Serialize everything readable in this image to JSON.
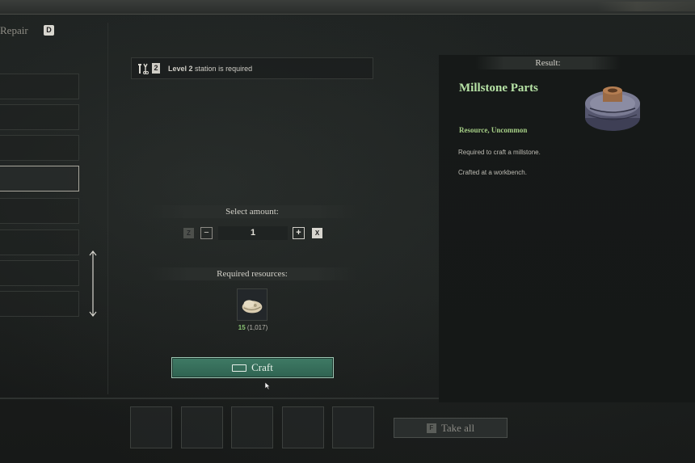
{
  "sidebar": {
    "tab_label": "Repair",
    "tab_key": "D"
  },
  "station": {
    "level_badge": "2",
    "level_text": "Level 2",
    "requirement_text": "station is required"
  },
  "amount": {
    "header": "Select amount:",
    "min_key": "Z",
    "decrement": "−",
    "value": "1",
    "increment": "+",
    "max_key": "X"
  },
  "resources": {
    "header": "Required resources:",
    "items": [
      {
        "name_icon": "bone-pile-icon",
        "required": "15",
        "owned": "(1,017)"
      }
    ]
  },
  "craft": {
    "label": "Craft"
  },
  "take_all": {
    "key": "F",
    "label": "Take all"
  },
  "result": {
    "header": "Result:",
    "name": "Millstone Parts",
    "rarity": "Resource, Uncommon",
    "description_1": "Required to craft a millstone.",
    "description_2": "Crafted at a workbench.",
    "icon": "millstone-icon"
  },
  "colors": {
    "accent_green": "#3f7a65",
    "result_name": "#b7e3a6",
    "rarity": "#a6cf86",
    "resource_owned": "#8bc574"
  }
}
